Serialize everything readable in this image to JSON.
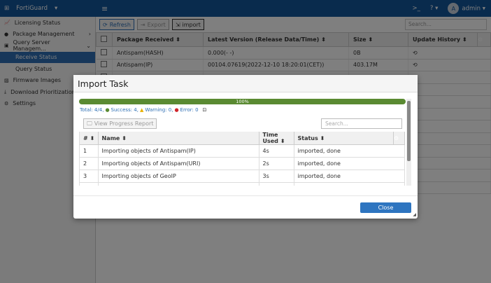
{
  "header": {
    "brand": "FortiGuard",
    "user": "admin",
    "avatar_letter": "A"
  },
  "sidebar": {
    "items": [
      {
        "label": "Licensing Status",
        "icon": "chart-icon"
      },
      {
        "label": "Package Management",
        "icon": "user-icon",
        "chevron": "›"
      },
      {
        "label": "Query Server Managem...",
        "icon": "id-card-icon",
        "chevron": "⌄"
      },
      {
        "label": "Receive Status",
        "sub": true,
        "active": true
      },
      {
        "label": "Query Status",
        "sub": true
      },
      {
        "label": "Firmware Images",
        "icon": "image-icon"
      },
      {
        "label": "Download Prioritization",
        "icon": "download-icon"
      },
      {
        "label": "Settings",
        "icon": "gear-icon"
      }
    ]
  },
  "toolbar": {
    "refresh": "Refresh",
    "export": "Export",
    "import": "import",
    "search_placeholder": "Search..."
  },
  "table": {
    "columns": [
      "Package Received",
      "Latest Version (Release Data/Time)",
      "Size",
      "Update History"
    ],
    "rows": [
      [
        "Antispam(HASH)",
        "0.000(- -)",
        "0B"
      ],
      [
        "Antispam(IP)",
        "00104.07619(2022-12-10 18:20:01(CET))",
        "403.17M"
      ],
      [
        "",
        "",
        ""
      ],
      [
        "",
        "",
        ""
      ],
      [
        "",
        "",
        ""
      ],
      [
        "",
        "",
        ""
      ],
      [
        "",
        "",
        ""
      ],
      [
        "",
        "",
        ""
      ],
      [
        "",
        "",
        ""
      ],
      [
        "",
        "",
        ""
      ],
      [
        "",
        "",
        ""
      ],
      [
        "",
        "",
        ""
      ]
    ]
  },
  "modal": {
    "title": "Import Task",
    "progress_label": "100%",
    "progress": 100,
    "summary": {
      "total": "Total: 4/4,",
      "success": "Success: 4,",
      "warning": "Warning: 0,",
      "error": "Error: 0"
    },
    "view_report": "View Progress Report",
    "search_placeholder": "Search...",
    "columns": [
      "#",
      "Name",
      "Time Used",
      "Status"
    ],
    "rows": [
      [
        "1",
        "Importing objects of Antispam(IP)",
        "4s",
        "imported, done"
      ],
      [
        "2",
        "Importing objects of Antispam(URI)",
        "2s",
        "imported, done"
      ],
      [
        "3",
        "Importing objects of GeoIP",
        "3s",
        "imported, done"
      ],
      [
        "",
        "",
        "",
        ""
      ]
    ],
    "close": "Close"
  },
  "colors": {
    "topbar": "#13569a",
    "accent": "#2e6fb4",
    "progress": "#5a8a32"
  }
}
